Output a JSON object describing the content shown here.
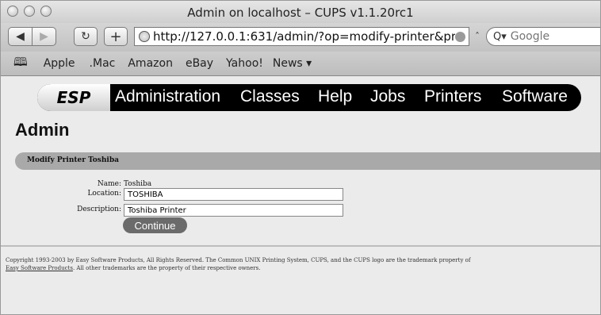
{
  "window": {
    "title": "Admin on localhost – CUPS v1.1.20rc1"
  },
  "toolbar": {
    "url": "http://127.0.0.1:631/admin/?op=modify-printer&pr",
    "search_placeholder": "Google"
  },
  "bookmarks": [
    "Apple",
    ".Mac",
    "Amazon",
    "eBay",
    "Yahoo!",
    "News ▾"
  ],
  "nav": {
    "logo": "ESP",
    "links": [
      "Administration",
      "Classes",
      "Help",
      "Jobs",
      "Printers",
      "Software"
    ]
  },
  "page": {
    "heading": "Admin",
    "section_title": "Modify Printer Toshiba",
    "name_label": "Name:",
    "name_value": "Toshiba",
    "location_label": "Location:",
    "location_value": "TOSHIBA",
    "description_label": "Description:",
    "description_value": "Toshiba Printer",
    "continue_label": "Continue"
  },
  "footer": {
    "line1": "Copyright 1993-2003 by Easy Software Products, All Rights Reserved. The Common UNIX Printing System, CUPS, and the CUPS logo are the trademark property of",
    "link": "Easy Software Products",
    "line2_rest": ". All other trademarks are the property of their respective owners."
  }
}
